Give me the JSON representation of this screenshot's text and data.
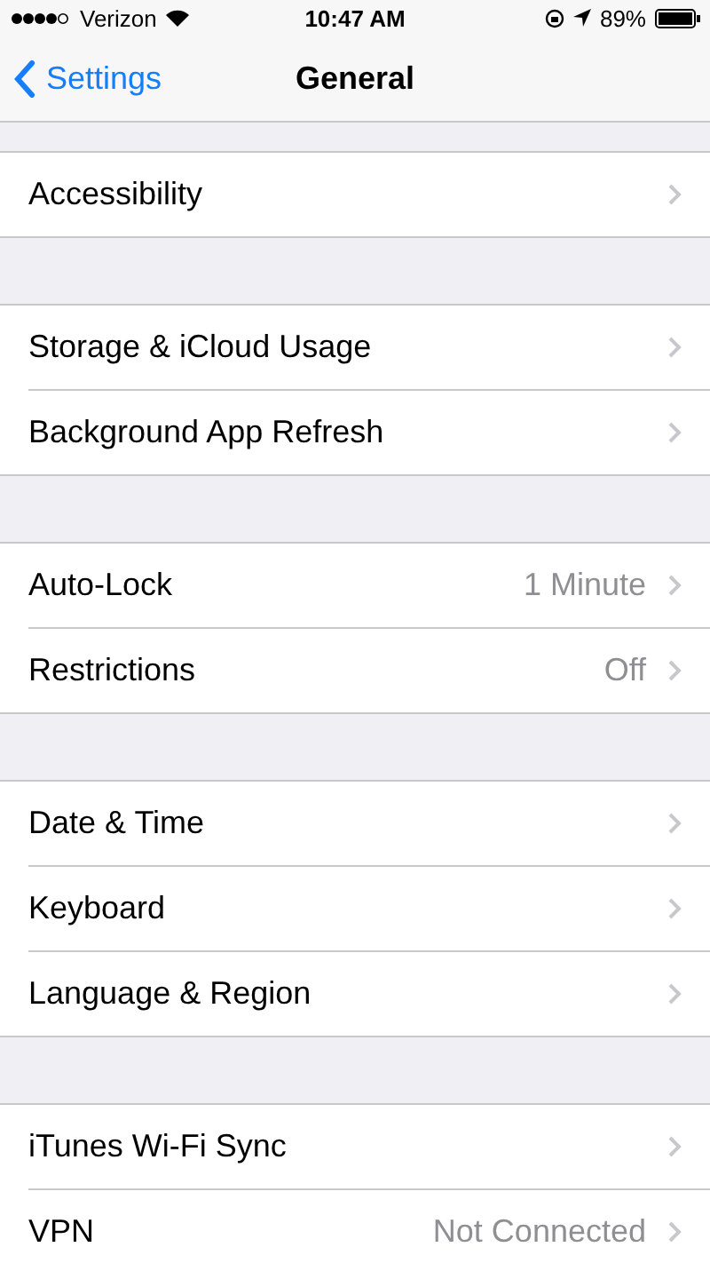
{
  "status_bar": {
    "carrier": "Verizon",
    "time": "10:47 AM",
    "battery": "89%"
  },
  "nav": {
    "back": "Settings",
    "title": "General"
  },
  "groups": [
    {
      "rows": [
        {
          "label": "Accessibility"
        }
      ]
    },
    {
      "rows": [
        {
          "label": "Storage & iCloud Usage"
        },
        {
          "label": "Background App Refresh"
        }
      ]
    },
    {
      "rows": [
        {
          "label": "Auto-Lock",
          "value": "1 Minute"
        },
        {
          "label": "Restrictions",
          "value": "Off"
        }
      ]
    },
    {
      "rows": [
        {
          "label": "Date & Time"
        },
        {
          "label": "Keyboard"
        },
        {
          "label": "Language & Region"
        }
      ]
    },
    {
      "rows": [
        {
          "label": "iTunes Wi-Fi Sync"
        },
        {
          "label": "VPN",
          "value": "Not Connected"
        }
      ]
    }
  ]
}
